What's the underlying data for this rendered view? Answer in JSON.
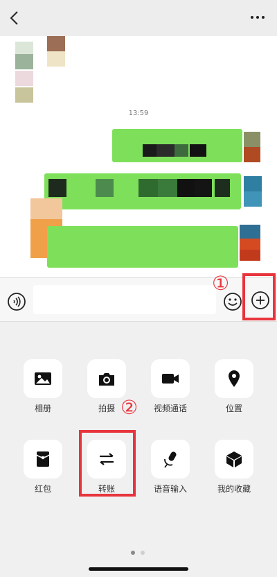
{
  "chat": {
    "timestamp": "13:59"
  },
  "panel": {
    "items": [
      {
        "label": "相册",
        "icon": "photo-album-icon"
      },
      {
        "label": "拍摄",
        "icon": "camera-icon"
      },
      {
        "label": "视频通话",
        "icon": "video-call-icon"
      },
      {
        "label": "位置",
        "icon": "location-pin-icon"
      },
      {
        "label": "红包",
        "icon": "red-packet-icon"
      },
      {
        "label": "转账",
        "icon": "transfer-icon"
      },
      {
        "label": "语音输入",
        "icon": "microphone-icon"
      },
      {
        "label": "我的收藏",
        "icon": "favorites-cube-icon"
      }
    ],
    "page_indicator": {
      "current": 1,
      "total": 2
    }
  },
  "annotations": {
    "step1": "①",
    "step2": "②",
    "color": "#e8353d"
  },
  "colors": {
    "bubble_green": "#7ee05a",
    "panel_bg": "#f0f0f0"
  }
}
